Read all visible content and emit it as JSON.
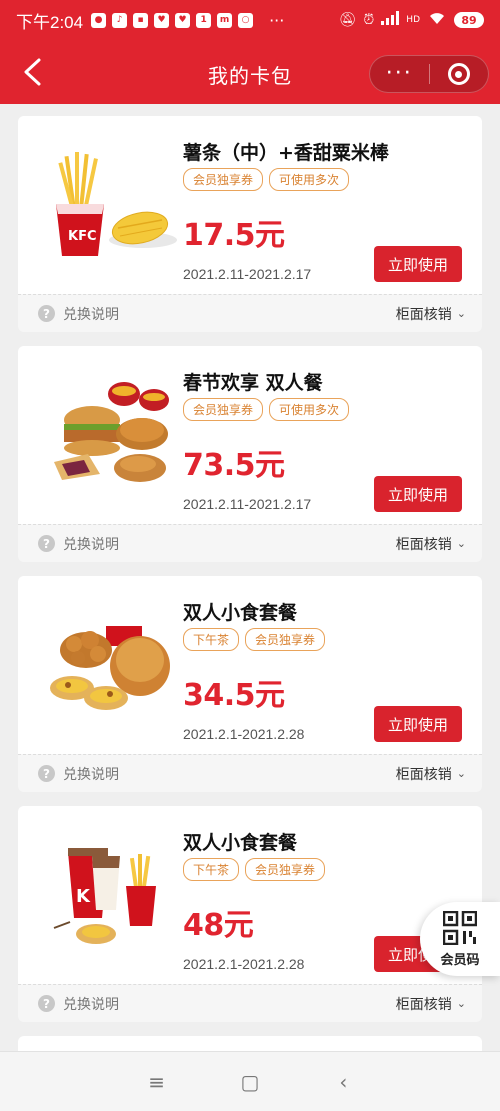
{
  "status_bar": {
    "time": "下午2:04",
    "app_icons": [
      "chat-bubble-icon",
      "tiktok-icon",
      "shop-icon",
      "heart-app-icon",
      "heart-app-icon",
      "one-icon",
      "mi-icon",
      "search-app-icon"
    ],
    "more": "···",
    "network_label": "HD",
    "battery": "89"
  },
  "nav": {
    "back_icon": "chevron-left-icon",
    "title": "我的卡包",
    "more_icon": "···"
  },
  "cards": [
    {
      "title": "薯条（中）+香甜粟米棒",
      "tags": [
        "会员独享券",
        "可使用多次"
      ],
      "price": "17.5元",
      "date": "2021.2.11-2021.2.17",
      "button": "立即使用",
      "footer_left": "兑换说明",
      "footer_right": "柜面核销",
      "image": "fries-corn"
    },
    {
      "title": "春节欢享 双人餐",
      "tags": [
        "会员独享券",
        "可使用多次"
      ],
      "price": "73.5元",
      "date": "2021.2.11-2021.2.17",
      "button": "立即使用",
      "footer_left": "兑换说明",
      "footer_right": "柜面核销",
      "image": "burger-meal"
    },
    {
      "title": "双人小食套餐",
      "tags": [
        "下午茶",
        "会员独享券"
      ],
      "price": "34.5元",
      "date": "2021.2.1-2021.2.28",
      "button": "立即使用",
      "footer_left": "兑换说明",
      "footer_right": "柜面核销",
      "image": "chicken-tarts"
    },
    {
      "title": "双人小食套餐",
      "tags": [
        "下午茶",
        "会员独享券"
      ],
      "price": "48元",
      "date": "2021.2.1-2021.2.28",
      "button": "立即使用",
      "footer_left": "兑换说明",
      "footer_right": "柜面核销",
      "image": "drinks-fries-tart"
    }
  ],
  "member_code": {
    "label": "会员码",
    "icon": "qr-code-icon"
  },
  "system_nav": {
    "menu": "≡",
    "home": "▢",
    "back": "‹"
  },
  "colors": {
    "brand_red": "#e0242f",
    "tag_orange": "#e9a35a"
  }
}
